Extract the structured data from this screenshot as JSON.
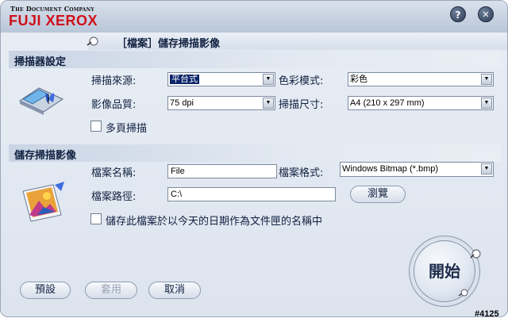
{
  "app": {
    "logo_tagline": "The Document Company",
    "logo_brand": "FUJI XEROX",
    "help_glyph": "?",
    "close_glyph": "✕"
  },
  "page": {
    "title": "［檔案］儲存掃描影像"
  },
  "scanner_settings": {
    "section_title": "掃描器設定",
    "source_label": "掃描來源:",
    "source_value": "平台式",
    "color_mode_label": "色彩模式:",
    "color_mode_value": "彩色",
    "quality_label": "影像品質:",
    "quality_value": "75 dpi",
    "scan_size_label": "掃描尺寸:",
    "scan_size_value": "A4 (210 x 297 mm)",
    "multi_page_label": "多頁掃描",
    "multi_page_checked": false
  },
  "save_settings": {
    "section_title": "儲存掃描影像",
    "filename_label": "檔案名稱:",
    "filename_value": "File",
    "format_label": "檔案格式:",
    "format_value": "Windows Bitmap (*.bmp)",
    "path_label": "檔案路徑:",
    "path_value": "C:\\",
    "browse_label": "瀏覽",
    "date_folder_label": "儲存此檔案於以今天的日期作為文件匣的名稱中",
    "date_folder_checked": false
  },
  "footer": {
    "default_label": "預設",
    "apply_label": "套用",
    "cancel_label": "取消",
    "start_label": "開始",
    "screen_id": "#4125"
  },
  "colors": {
    "brand_red": "#d0101a",
    "selection": "#0a246a",
    "text": "#102040"
  }
}
